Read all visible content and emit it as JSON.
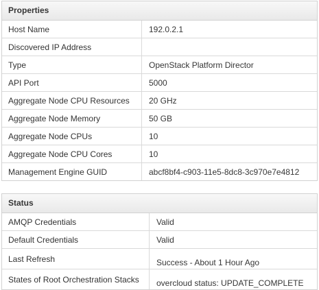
{
  "properties": {
    "title": "Properties",
    "rows": [
      {
        "label": "Host Name",
        "value": "192.0.2.1"
      },
      {
        "label": "Discovered IP Address",
        "value": ""
      },
      {
        "label": "Type",
        "value": "OpenStack Platform Director"
      },
      {
        "label": "API Port",
        "value": "5000"
      },
      {
        "label": "Aggregate Node CPU Resources",
        "value": "20 GHz"
      },
      {
        "label": "Aggregate Node Memory",
        "value": "50 GB"
      },
      {
        "label": "Aggregate Node CPUs",
        "value": "10"
      },
      {
        "label": "Aggregate Node CPU Cores",
        "value": "10"
      },
      {
        "label": "Management Engine GUID",
        "value": "abcf8bf4-c903-11e5-8dc8-3c970e7e4812"
      }
    ]
  },
  "status": {
    "title": "Status",
    "rows": [
      {
        "label": "AMQP Credentials",
        "value": "Valid"
      },
      {
        "label": "Default Credentials",
        "value": "Valid"
      },
      {
        "label": "Last Refresh",
        "value": "Success - About 1 Hour Ago"
      },
      {
        "label": "States of Root Orchestration Stacks",
        "value": "overcloud status: UPDATE_COMPLETE"
      }
    ]
  }
}
